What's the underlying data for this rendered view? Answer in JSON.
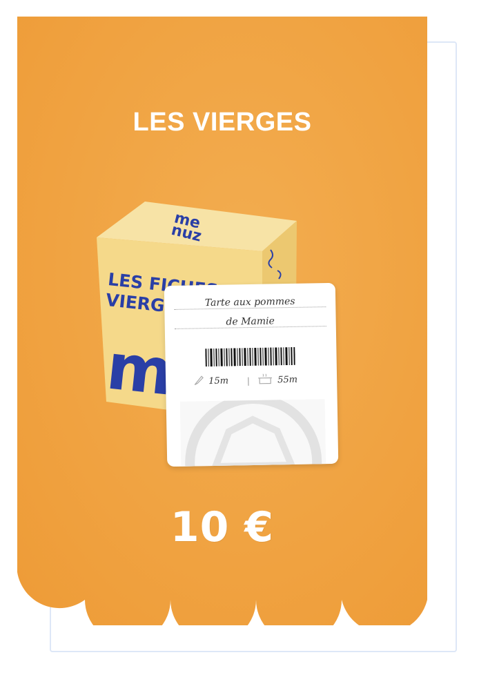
{
  "product": {
    "title": "LES VIERGES",
    "price": "10 €"
  },
  "box": {
    "logo_line1": "me",
    "logo_line2": "nuz",
    "text_line1": "LES FICHES",
    "text_line2": "VIERG"
  },
  "recipe_card": {
    "line1": "Tarte aux pommes",
    "line2": "de Mamie",
    "prep_time": "15m",
    "cook_time": "55m",
    "prep_icon": "knife-icon",
    "cook_icon": "pot-icon"
  },
  "colors": {
    "orange": "#f0a242",
    "box_yellow": "#f5d98a",
    "navy": "#2a3fa6"
  }
}
